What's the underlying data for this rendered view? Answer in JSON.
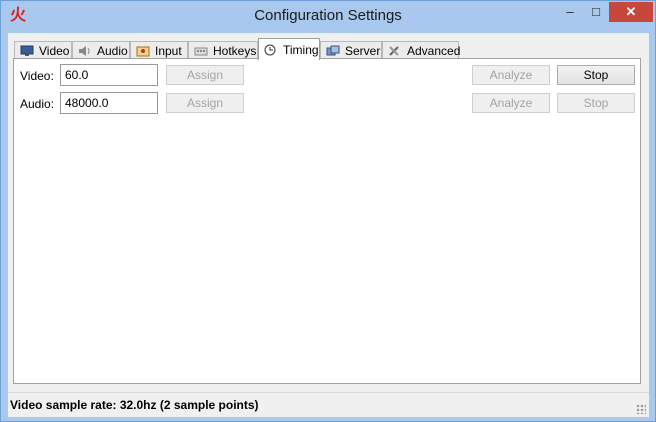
{
  "window": {
    "title": "Configuration Settings",
    "app_icon_glyph": "火",
    "min_glyph": "–",
    "max_glyph": "□",
    "close_glyph": "✕"
  },
  "tabs": [
    {
      "label": "Video",
      "icon": "monitor-icon"
    },
    {
      "label": "Audio",
      "icon": "speaker-icon"
    },
    {
      "label": "Input",
      "icon": "input-icon"
    },
    {
      "label": "Hotkeys",
      "icon": "keyboard-icon"
    },
    {
      "label": "Timing",
      "icon": "clock-icon"
    },
    {
      "label": "Server",
      "icon": "server-icon"
    },
    {
      "label": "Advanced",
      "icon": "tools-icon"
    }
  ],
  "active_tab": "Timing",
  "timing": {
    "video_label": "Video:",
    "video_value": "60.0",
    "audio_label": "Audio:",
    "audio_value": "48000.0",
    "assign_label": "Assign",
    "analyze_label": "Analyze",
    "stop_label": "Stop"
  },
  "status": {
    "text": "Video sample rate: 32.0hz (2 sample points)"
  }
}
